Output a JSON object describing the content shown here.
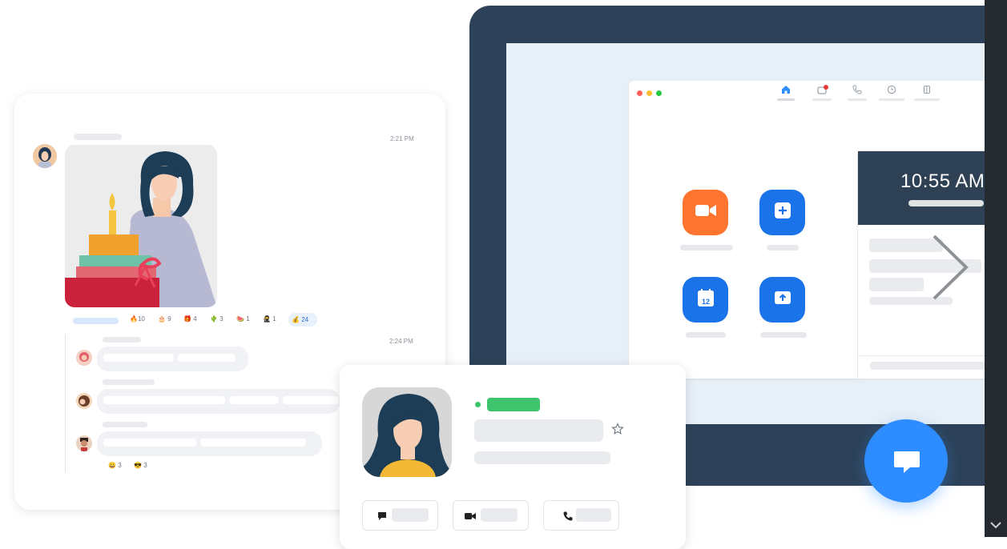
{
  "chat": {
    "timestamp_1": "2:21 PM",
    "timestamp_2": "2:24 PM",
    "reactions": [
      {
        "icon": "fire-icon",
        "glyph": "🔥",
        "count": "10"
      },
      {
        "icon": "cake-icon",
        "glyph": "🎂",
        "count": "9"
      },
      {
        "icon": "gift-icon",
        "glyph": "🎁",
        "count": "4"
      },
      {
        "icon": "cactus-icon",
        "glyph": "🌵",
        "count": "3"
      },
      {
        "icon": "watermelon-icon",
        "glyph": "🍉",
        "count": "1"
      },
      {
        "icon": "ninja-icon",
        "glyph": "🥷",
        "count": "1"
      }
    ],
    "active_reaction": {
      "icon": "money-bag-icon",
      "glyph": "💰",
      "count": "24"
    },
    "bottom_reactions": [
      {
        "icon": "grin-icon",
        "glyph": "😀",
        "count": "3"
      },
      {
        "icon": "cool-icon",
        "glyph": "😎",
        "count": "3"
      }
    ]
  },
  "clock": {
    "time": "10:55 AM"
  },
  "colors": {
    "accent_blue": "#2d8cff",
    "orange": "#ff742e",
    "online_green": "#3ec46d",
    "laptop_frame": "#2d4259",
    "badge_red": "#e53935"
  },
  "icons": {
    "window_controls": [
      "red-dot",
      "yellow-dot",
      "green-dot"
    ],
    "nav": [
      "home-icon",
      "chat-icon",
      "phone-icon",
      "clock-icon",
      "contacts-icon"
    ],
    "app_buttons": [
      "video-icon",
      "plus-icon",
      "calendar-icon",
      "share-icon"
    ],
    "calendar_day": "12",
    "profile_actions": [
      "chat-icon",
      "video-icon",
      "phone-icon"
    ]
  }
}
